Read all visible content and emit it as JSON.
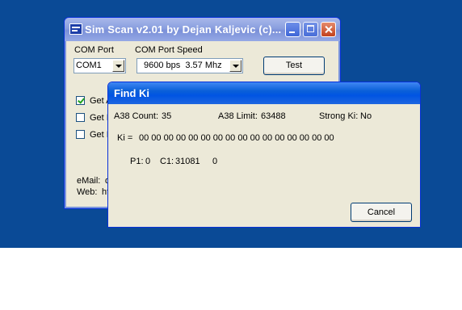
{
  "main_window": {
    "title": "Sim Scan v2.01 by Dejan Kaljevic (c)...",
    "com_port_label": "COM Port",
    "com_port_value": "COM1",
    "com_speed_label": "COM Port Speed",
    "com_speed_value": "9600 bps  3.57 Mhz",
    "test_button": "Test",
    "checkboxes": [
      {
        "label": "Get A",
        "checked": true
      },
      {
        "label": "Get I",
        "checked": false
      },
      {
        "label": "Get I",
        "checked": false
      }
    ],
    "email_label": "eMail:",
    "email_value": "d",
    "web_label": "Web:",
    "web_value": "ht"
  },
  "dialog": {
    "title": "Find Ki",
    "a38_count_label": "A38 Count:",
    "a38_count_value": "35",
    "a38_limit_label": "A38 Limit:",
    "a38_limit_value": "63488",
    "strong_ki_label": "Strong Ki:",
    "strong_ki_value": "No",
    "ki_label": "Ki =",
    "ki_value": "00 00 00 00 00 00 00 00 00 00 00 00 00 00 00 00",
    "p1_label": "P1:",
    "p1_value": "0",
    "c1_label": "C1:",
    "c1_value": "31081",
    "extra_value": "0",
    "cancel_button": "Cancel"
  },
  "colors": {
    "desktop": "#0a4a96",
    "active_title": "#0054e3",
    "inactive_title": "#8a9fdf",
    "window_face": "#ece9d8"
  }
}
